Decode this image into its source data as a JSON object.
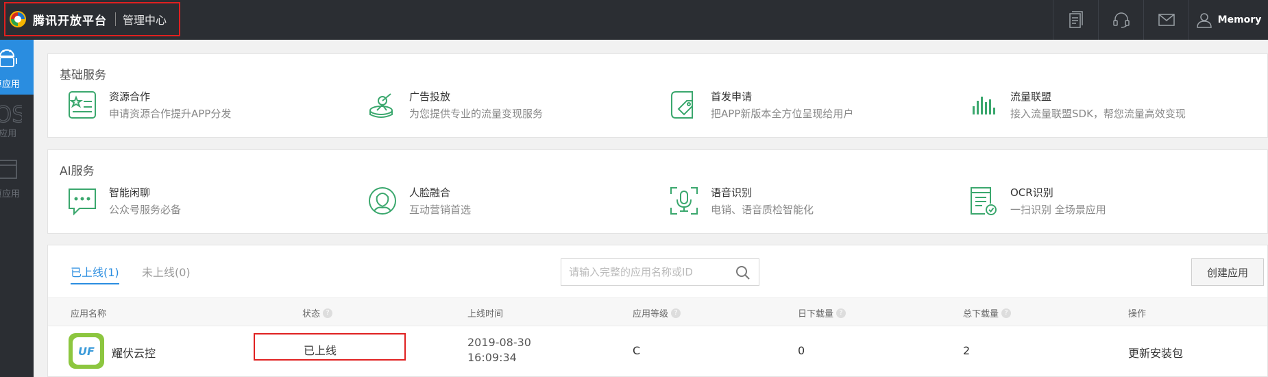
{
  "header": {
    "brand_name": "腾讯开放平台",
    "brand_sub": "管理中心",
    "user_name": "Memory",
    "icons": [
      "document-icon",
      "headset-icon",
      "mail-icon",
      "user-icon"
    ]
  },
  "sidebar": {
    "items": [
      {
        "label": "卓应用",
        "icon": "android-icon",
        "active": true
      },
      {
        "label": "S应用",
        "icon": "ios-icon",
        "active": false
      },
      {
        "label": "页应用",
        "icon": "browser-icon",
        "active": false
      }
    ]
  },
  "basic_services": {
    "title": "基础服务",
    "items": [
      {
        "name": "资源合作",
        "desc": "申请资源合作提升APP分发",
        "icon": "resource-cooperation-icon"
      },
      {
        "name": "广告投放",
        "desc": "为您提供专业的流量变现服务",
        "icon": "ad-delivery-icon"
      },
      {
        "name": "首发申请",
        "desc": "把APP新版本全方位呈现给用户",
        "icon": "first-release-icon"
      },
      {
        "name": "流量联盟",
        "desc": "接入流量联盟SDK，帮您流量高效变现",
        "icon": "traffic-alliance-icon"
      }
    ]
  },
  "ai_services": {
    "title": "AI服务",
    "items": [
      {
        "name": "智能闲聊",
        "desc": "公众号服务必备",
        "icon": "chat-icon"
      },
      {
        "name": "人脸融合",
        "desc": "互动营销首选",
        "icon": "face-fusion-icon"
      },
      {
        "name": "语音识别",
        "desc": "电销、语音质检智能化",
        "icon": "voice-recognition-icon"
      },
      {
        "name": "OCR识别",
        "desc": "一扫识别 全场景应用",
        "icon": "ocr-icon"
      }
    ]
  },
  "apps": {
    "tabs": [
      {
        "label": "已上线(1)",
        "active": true
      },
      {
        "label": "未上线(0)",
        "active": false
      }
    ],
    "search_placeholder": "请输入完整的应用名称或ID",
    "create_label": "创建应用",
    "columns": [
      {
        "label": "应用名称",
        "help": false
      },
      {
        "label": "状态",
        "help": true
      },
      {
        "label": "上线时间",
        "help": false
      },
      {
        "label": "应用等级",
        "help": true
      },
      {
        "label": "日下载量",
        "help": true
      },
      {
        "label": "总下载量",
        "help": true
      },
      {
        "label": "操作",
        "help": false
      }
    ],
    "rows": [
      {
        "icon_text": "UF",
        "name": "耀伏云控",
        "status": "已上线",
        "date": "2019-08-30",
        "time": "16:09:34",
        "level": "C",
        "daily_downloads": "0",
        "total_downloads": "2",
        "action": "更新安装包"
      }
    ]
  },
  "colors": {
    "accent": "#2a8de0",
    "green": "#3aa76d",
    "dark": "#2b2e33",
    "highlight_red": "#e02020"
  }
}
